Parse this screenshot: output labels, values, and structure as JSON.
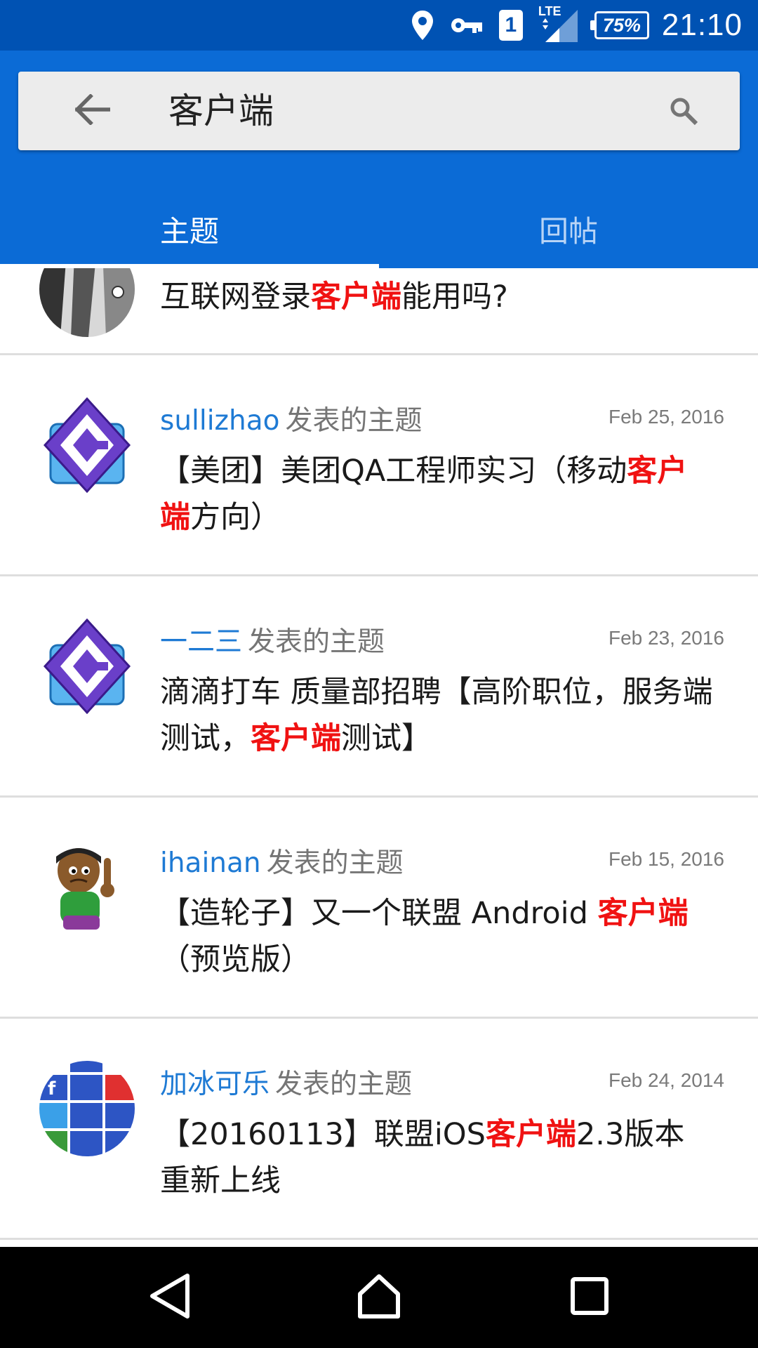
{
  "status_bar": {
    "battery_percent": "75%",
    "time": "21:10",
    "sim_slot": "1",
    "network_type": "LTE",
    "icons": [
      "location-icon",
      "vpn-key-icon",
      "sim-icon",
      "signal-icon",
      "battery-icon"
    ]
  },
  "search": {
    "query": "客户端"
  },
  "tabs": [
    {
      "label": "主题",
      "active": true
    },
    {
      "label": "回帖",
      "active": false
    }
  ],
  "colors": {
    "status_bar": "#0052b3",
    "app_bar": "#0b6bd6",
    "author": "#1e7ad4",
    "highlight": "#f01212"
  },
  "results": [
    {
      "title_before": "互联网登录",
      "title_highlight": "客户端",
      "title_after": "能用吗?",
      "partially_visible": true
    },
    {
      "author": "sullizhao",
      "action": "发表的主题",
      "date": "Feb 25, 2016",
      "title_before": "【美团】美团QA工程师实习（移动",
      "title_highlight": "客户端",
      "title_after": "方向）"
    },
    {
      "author": "一二三",
      "action": "发表的主题",
      "date": "Feb 23, 2016",
      "title_before": "滴滴打车 质量部招聘【高阶职位，服务端测试，",
      "title_highlight": "客户端",
      "title_after": "测试】"
    },
    {
      "author": "ihainan",
      "action": "发表的主题",
      "date": "Feb 15, 2016",
      "title_before": "【造轮子】又一个联盟 Android ",
      "title_highlight": "客户端",
      "title_after": "（预览版）"
    },
    {
      "author": "加冰可乐",
      "action": "发表的主题",
      "date": "Feb 24, 2014",
      "title_before": "【20160113】联盟iOS",
      "title_highlight": "客户端",
      "title_after": "2.3版本重新上线"
    }
  ]
}
